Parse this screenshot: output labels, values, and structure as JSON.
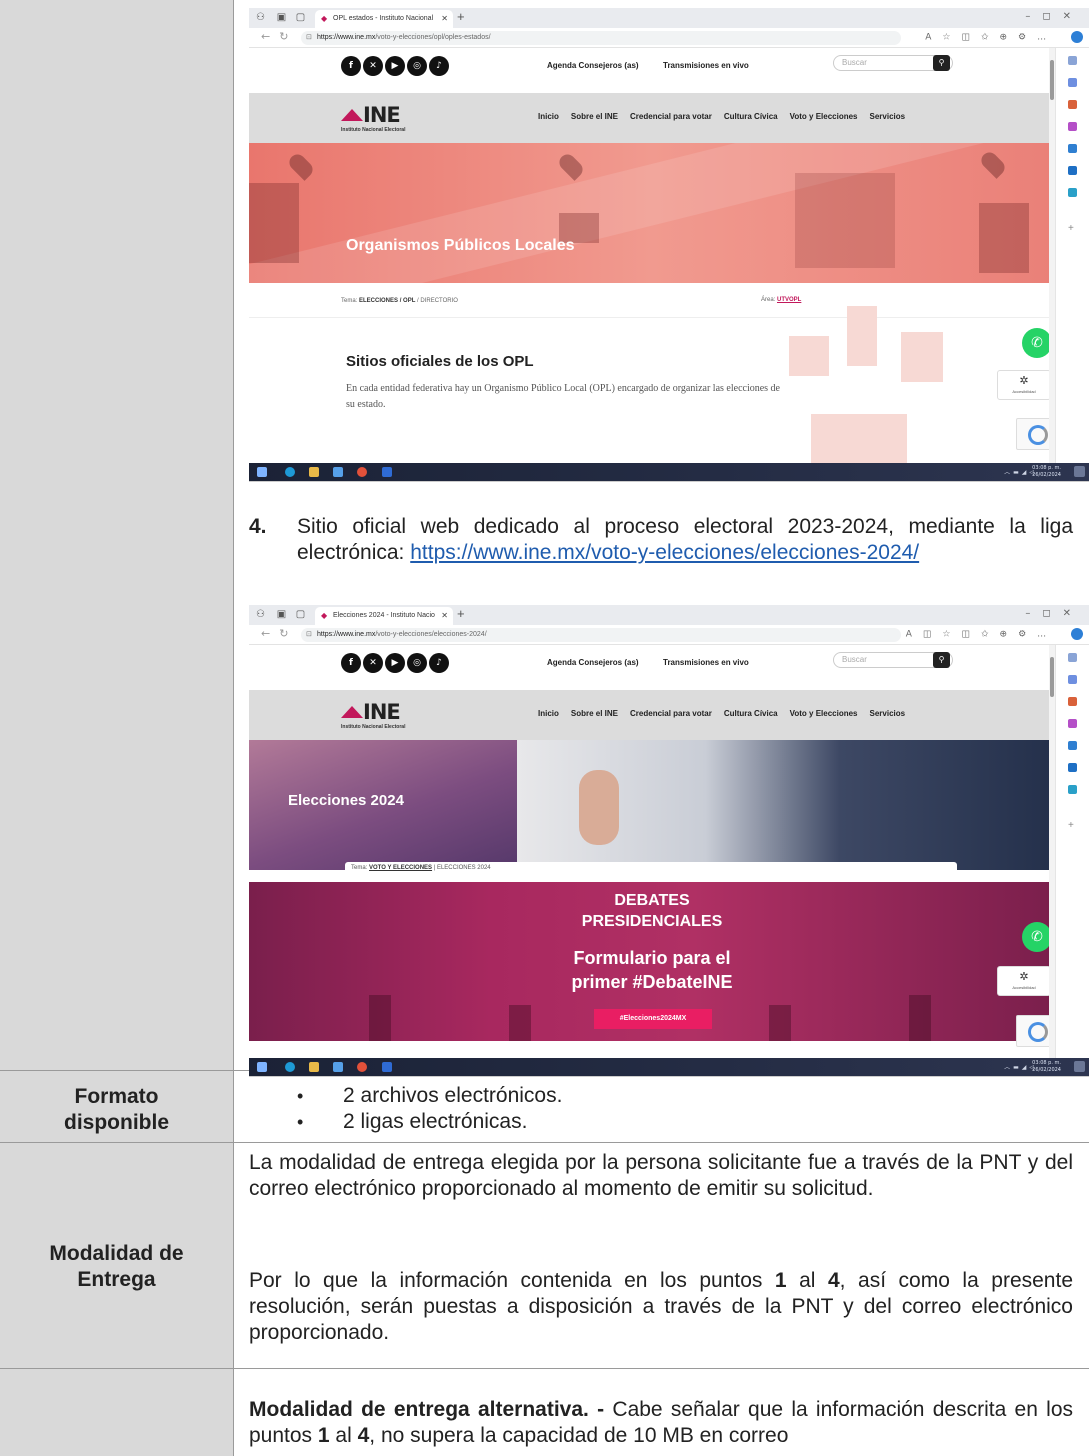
{
  "browser1": {
    "tab_title": "OPL estados - Instituto Nacional",
    "url_host": "https://www.ine.mx",
    "url_path": "/voto-y-elecciones/opl/oples-estados/",
    "site": {
      "top_links": [
        "Agenda Consejeros (as)",
        "Transmisiones en vivo"
      ],
      "search_placeholder": "Buscar",
      "logo": "INE",
      "logo_sub": "Instituto Nacional Electoral",
      "menu": [
        "Inicio",
        "Sobre el INE",
        "Credencial para votar",
        "Cultura Cívica",
        "Voto y Elecciones",
        "Servicios"
      ],
      "hero_title": "Organismos Públicos Locales",
      "crumb_prefix": "Tema:",
      "crumb_bold": "ELECCIONES / OPL",
      "crumb_rest": " / DIRECTORIO",
      "area_label": "Área:",
      "area_link": "UTVOPL",
      "section_title": "Sitios oficiales de los OPL",
      "section_text": "En cada entidad federativa hay un Organismo Público Local (OPL) encargado de organizar las elecciones de su estado.",
      "accessibility": "Accesibilidad"
    },
    "clock_time": "03:08 p. m.",
    "clock_date": "26/02/2024"
  },
  "item4": {
    "number": "4.",
    "text": "Sitio oficial web dedicado al proceso electoral 2023-2024, mediante la liga electrónica: ",
    "link": "https://www.ine.mx/voto-y-elecciones/elecciones-2024/"
  },
  "browser2": {
    "tab_title": "Elecciones 2024 - Instituto Nacio",
    "url_host": "https://www.ine.mx",
    "url_path": "/voto-y-elecciones/elecciones-2024/",
    "site": {
      "top_links": [
        "Agenda Consejeros (as)",
        "Transmisiones en vivo"
      ],
      "search_placeholder": "Buscar",
      "logo": "INE",
      "logo_sub": "Instituto Nacional Electoral",
      "menu": [
        "Inicio",
        "Sobre el INE",
        "Credencial para votar",
        "Cultura Cívica",
        "Voto y Elecciones",
        "Servicios"
      ],
      "hero_title": "Elecciones 2024",
      "crumb_prefix": "Tema:",
      "crumb_bold": "VOTO Y ELECCIONES",
      "crumb_rest": " | ELECCIONES 2024",
      "banner_line1": "DEBATES",
      "banner_line2": "PRESIDENCIALES",
      "banner_line3": "Formulario para el",
      "banner_line4": "primer #DebateINE",
      "banner_hashtag": "#Elecciones2024MX",
      "accessibility": "Accesibilidad"
    },
    "clock_time": "03:08 p. m.",
    "clock_date": "26/02/2024"
  },
  "rows": {
    "formato": {
      "label": "Formato disponible",
      "bullets": [
        "2 archivos electrónicos.",
        "2 ligas electrónicas."
      ]
    },
    "modalidad": {
      "label": "Modalidad de Entrega",
      "p1": "La modalidad de entrega elegida por la persona solicitante fue a través de la PNT y del correo electrónico proporcionado al momento de emitir su solicitud.",
      "p2_a": "Por lo que la información contenida en los puntos ",
      "p2_n1": "1",
      "p2_b": " al ",
      "p2_n2": "4",
      "p2_c": ", así como la presente resolución, serán puestas a disposición a través de la PNT y del correo electrónico proporcionado."
    },
    "alternativa": {
      "bold": "Modalidad de entrega alternativa. -",
      "a": " Cabe señalar que la información descrita en los puntos ",
      "n1": "1",
      "b": " al ",
      "n2": "4",
      "c": ", no supera la capacidad de 10 MB en correo"
    }
  }
}
